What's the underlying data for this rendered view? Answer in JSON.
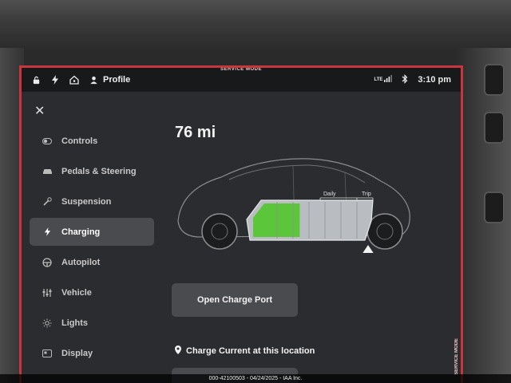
{
  "status_bar": {
    "profile": "Profile",
    "network": "LTE",
    "time": "3:10 pm",
    "service_mode": "SERVICE MODE"
  },
  "nav": {
    "items": [
      {
        "label": "Controls",
        "icon": "toggle-icon"
      },
      {
        "label": "Pedals & Steering",
        "icon": "car-icon"
      },
      {
        "label": "Suspension",
        "icon": "wrench-icon"
      },
      {
        "label": "Charging",
        "icon": "bolt-icon",
        "active": true
      },
      {
        "label": "Autopilot",
        "icon": "steering-wheel-icon"
      },
      {
        "label": "Vehicle",
        "icon": "sliders-icon"
      },
      {
        "label": "Lights",
        "icon": "sun-icon"
      },
      {
        "label": "Display",
        "icon": "display-icon"
      }
    ]
  },
  "main": {
    "range": "76 mi",
    "gauge_daily": "Daily",
    "gauge_trip": "Trip",
    "charge_level_percent": 40,
    "open_port_label": "Open Charge Port",
    "charge_current_label": "Charge Current at this location"
  },
  "watermark": "000-42100503 - 04/24/2025 - IAA Inc.",
  "colors": {
    "accent_red": "#c8363d",
    "battery_green": "#5cc63a"
  }
}
